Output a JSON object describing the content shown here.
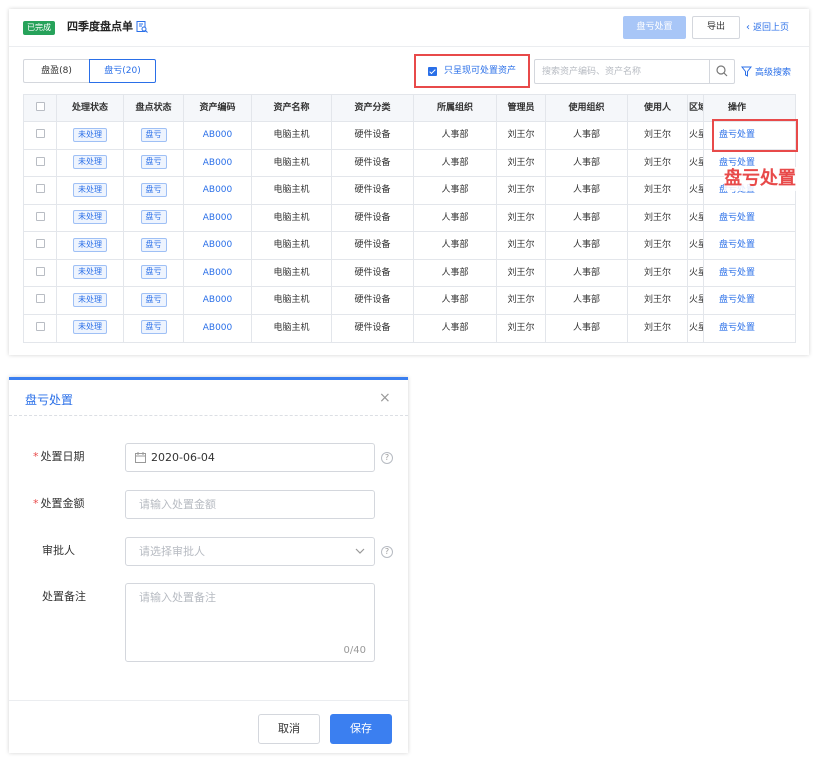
{
  "header": {
    "status_badge": "已完成",
    "title": "四季度盘点单",
    "loss_dispose_button": "盘亏处置",
    "export_button": "导出",
    "back_link": "返回上页"
  },
  "tabs": [
    {
      "label": "盘盈(8)"
    },
    {
      "label": "盘亏(20)"
    }
  ],
  "filter": {
    "only_disposable_label": "只呈现可处置资产",
    "search_placeholder": "搜索资产编码、资产名称",
    "advanced_search": "高级搜索"
  },
  "table": {
    "columns": [
      "处理状态",
      "盘点状态",
      "资产编码",
      "资产名称",
      "资产分类",
      "所属组织",
      "管理员",
      "使用组织",
      "使用人",
      "区域",
      "操作"
    ],
    "rows": [
      {
        "process_status": "未处理",
        "check_status": "盘亏",
        "code": "AB000",
        "name": "电脑主机",
        "category": "硬件设备",
        "org": "人事部",
        "admin": "刘王尔",
        "use_org": "人事部",
        "user": "刘王尔",
        "area": "火星",
        "action": "盘亏处置"
      },
      {
        "process_status": "未处理",
        "check_status": "盘亏",
        "code": "AB000",
        "name": "电脑主机",
        "category": "硬件设备",
        "org": "人事部",
        "admin": "刘王尔",
        "use_org": "人事部",
        "user": "刘王尔",
        "area": "火星",
        "action": "盘亏处置"
      },
      {
        "process_status": "未处理",
        "check_status": "盘亏",
        "code": "AB000",
        "name": "电脑主机",
        "category": "硬件设备",
        "org": "人事部",
        "admin": "刘王尔",
        "use_org": "人事部",
        "user": "刘王尔",
        "area": "火星",
        "action": "盘亏处置"
      },
      {
        "process_status": "未处理",
        "check_status": "盘亏",
        "code": "AB000",
        "name": "电脑主机",
        "category": "硬件设备",
        "org": "人事部",
        "admin": "刘王尔",
        "use_org": "人事部",
        "user": "刘王尔",
        "area": "火星",
        "action": "盘亏处置"
      },
      {
        "process_status": "未处理",
        "check_status": "盘亏",
        "code": "AB000",
        "name": "电脑主机",
        "category": "硬件设备",
        "org": "人事部",
        "admin": "刘王尔",
        "use_org": "人事部",
        "user": "刘王尔",
        "area": "火星",
        "action": "盘亏处置"
      },
      {
        "process_status": "未处理",
        "check_status": "盘亏",
        "code": "AB000",
        "name": "电脑主机",
        "category": "硬件设备",
        "org": "人事部",
        "admin": "刘王尔",
        "use_org": "人事部",
        "user": "刘王尔",
        "area": "火星",
        "action": "盘亏处置"
      },
      {
        "process_status": "未处理",
        "check_status": "盘亏",
        "code": "AB000",
        "name": "电脑主机",
        "category": "硬件设备",
        "org": "人事部",
        "admin": "刘王尔",
        "use_org": "人事部",
        "user": "刘王尔",
        "area": "火星",
        "action": "盘亏处置"
      },
      {
        "process_status": "未处理",
        "check_status": "盘亏",
        "code": "AB000",
        "name": "电脑主机",
        "category": "硬件设备",
        "org": "人事部",
        "admin": "刘王尔",
        "use_org": "人事部",
        "user": "刘王尔",
        "area": "火星",
        "action": "盘亏处置"
      }
    ]
  },
  "annotation": "盘亏处置",
  "dialog": {
    "title": "盘亏处置",
    "date_label": "处置日期",
    "date_value": "2020-06-04",
    "amount_label": "处置金额",
    "amount_placeholder": "请输入处置金额",
    "approver_label": "审批人",
    "approver_placeholder": "请选择审批人",
    "remark_label": "处置备注",
    "remark_placeholder": "请输入处置备注",
    "remark_counter": "0/40",
    "cancel_button": "取消",
    "save_button": "保存"
  },
  "colors": {
    "primary": "#2a6fe8",
    "success": "#26a25a",
    "highlight": "#e84a4a"
  },
  "icons": [
    "doc-search-icon",
    "chevron-left-icon",
    "search-icon",
    "filter-icon",
    "calendar-icon",
    "help-icon",
    "chevron-down-icon",
    "close-icon",
    "checkbox-icon"
  ]
}
